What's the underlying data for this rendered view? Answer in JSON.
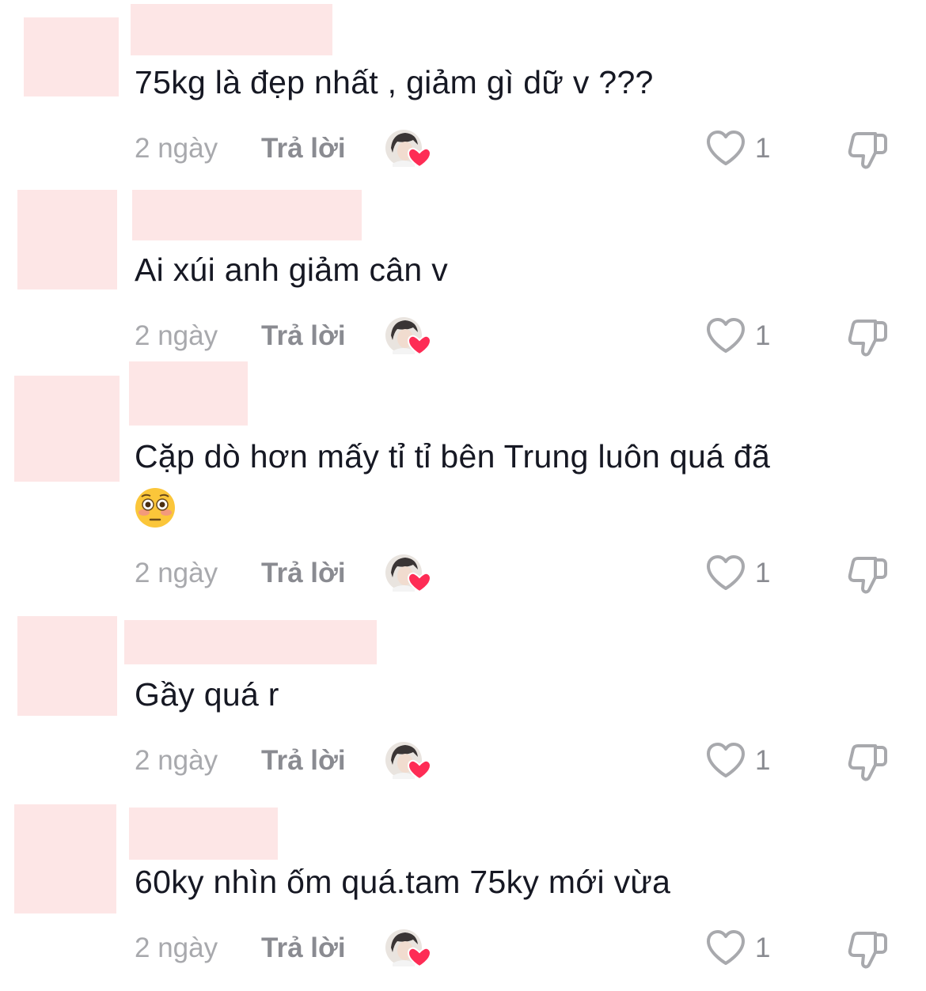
{
  "comments": [
    {
      "text": "75kg là đẹp nhất , giảm gì dữ v ???",
      "time": "2 ngày",
      "reply_label": "Trả lời",
      "like_count": "1"
    },
    {
      "text": "Ai xúi anh giảm cân v",
      "time": "2 ngày",
      "reply_label": "Trả lời",
      "like_count": "1"
    },
    {
      "text": "Cặp dò hơn mấy tỉ tỉ bên Trung luôn quá đã",
      "emoji": "flushed-face",
      "time": "2 ngày",
      "reply_label": "Trả lời",
      "like_count": "1"
    },
    {
      "text": "Gầy quá r",
      "time": "2 ngày",
      "reply_label": "Trả lời",
      "like_count": "1"
    },
    {
      "text": "60ky nhìn ốm quá.tam 75ky mới vừa",
      "time": "2 ngày",
      "reply_label": "Trả lời",
      "like_count": "1"
    }
  ],
  "colors": {
    "redaction": "#fde6e6",
    "creator_heart": "#fe2c55",
    "muted_text": "#a8a9ad"
  }
}
